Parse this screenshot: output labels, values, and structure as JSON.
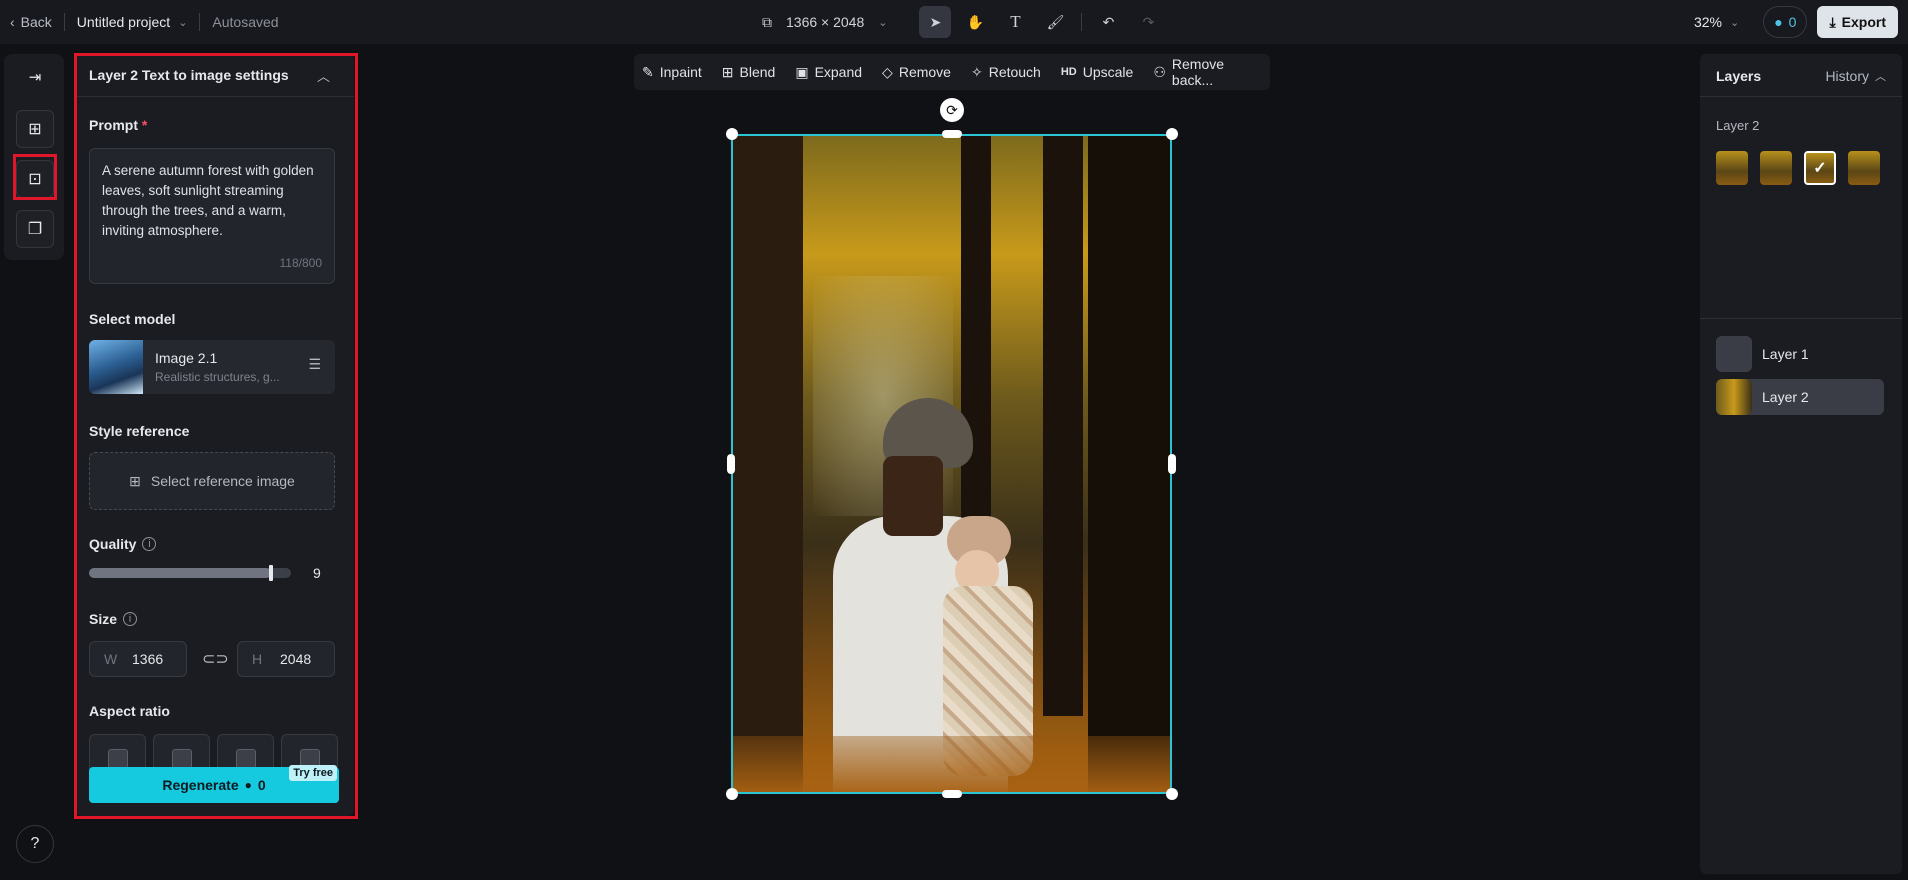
{
  "topbar": {
    "back_label": "Back",
    "project_name": "Untitled project",
    "autosaved": "Autosaved",
    "canvas_size": "1366 × 2048",
    "zoom": "32%",
    "credits": "0",
    "export_label": "Export"
  },
  "panel": {
    "title": "Layer 2 Text to image settings",
    "prompt_label": "Prompt",
    "prompt_required": "*",
    "prompt_text": "A serene autumn forest with golden leaves, soft sunlight streaming through the trees, and a warm, inviting atmosphere.",
    "prompt_counter": "118/800",
    "model_label": "Select model",
    "model_name": "Image 2.1",
    "model_desc": "Realistic structures, g...",
    "style_label": "Style reference",
    "style_button": "Select reference image",
    "quality_label": "Quality",
    "quality_value": "9",
    "quality_fraction": 0.9,
    "size_label": "Size",
    "width_key": "W",
    "width_value": "1366",
    "height_key": "H",
    "height_value": "2048",
    "aspect_label": "Aspect ratio",
    "regen_label": "Regenerate",
    "regen_cost": "0",
    "try_free": "Try free"
  },
  "canvas_toolbar": {
    "items": [
      "Inpaint",
      "Blend",
      "Expand",
      "Remove",
      "Retouch",
      "Upscale",
      "Remove back..."
    ],
    "upscale_badge": "HD"
  },
  "right_panel": {
    "layers_tab": "Layers",
    "history_tab": "History",
    "group_label": "Layer 2",
    "layers": [
      "Layer 1",
      "Layer 2"
    ]
  },
  "colors": {
    "accent": "#15c9df",
    "highlight": "#e0172b",
    "selection": "#2bc4d4"
  }
}
